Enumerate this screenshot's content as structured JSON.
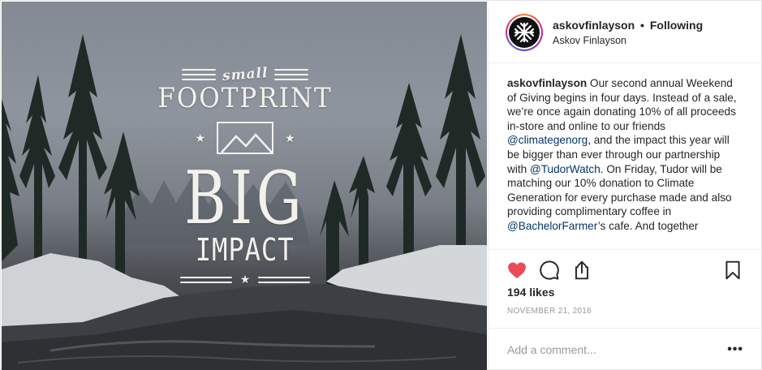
{
  "post_image": {
    "overlay": {
      "small": "small",
      "footprint": "FOOTPRINT",
      "big": "BIG",
      "impact": "IMPACT"
    }
  },
  "header": {
    "username": "askovfinlayson",
    "separator": "•",
    "follow_status": "Following",
    "display_name": "Askov Finlayson"
  },
  "caption": {
    "username": "askovfinlayson",
    "parts": [
      " Our second annual Weekend of Giving begins in four days. Instead of a sale, we’re once again donating 10% of all proceeds in-store and online to our friends ",
      "@climategenorg",
      ", and the impact this year will be bigger than ever through our partnership with ",
      "@TudorWatch",
      ". On Friday, Tudor will be matching our 10% donation to Climate Generation for every purchase made and also providing complimentary coffee in ",
      "@BachelorFarmer",
      "’s cafe. And together"
    ]
  },
  "actions": {
    "like_icon": "heart-filled-icon",
    "comment_icon": "speech-bubble-icon",
    "share_icon": "share-icon",
    "save_icon": "bookmark-icon",
    "like_color": "#ed4956"
  },
  "likes": "194 likes",
  "date": "NOVEMBER 21, 2016",
  "comment_box": {
    "placeholder": "Add a comment...",
    "more_label": "•••"
  }
}
